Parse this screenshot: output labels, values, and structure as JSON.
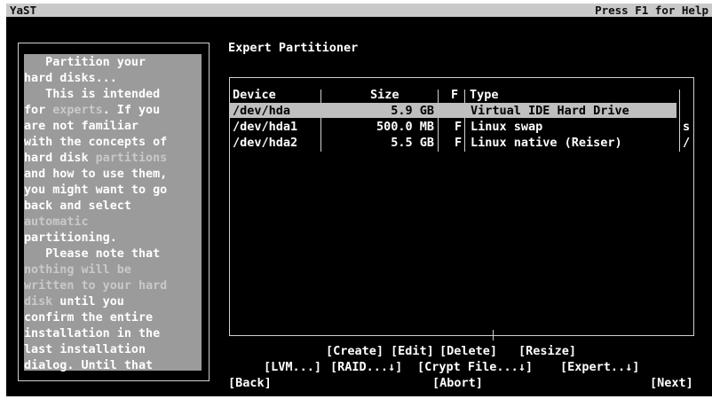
{
  "topbar": {
    "app_name": "YaST",
    "help_hint": "Press F1 for Help"
  },
  "help": {
    "lines": [
      {
        "text": "   Partition your",
        "dim": false
      },
      {
        "text": "hard disks...",
        "dim": false
      },
      {
        "text": "   This is intended",
        "dim": false
      },
      {
        "text": "for ",
        "dim": false,
        "parts": [
          {
            "text": "for ",
            "dim": false
          },
          {
            "text": "experts",
            "dim": true
          },
          {
            "text": ". If you",
            "dim": false
          }
        ]
      },
      {
        "text": "are not familiar",
        "dim": false
      },
      {
        "text": "with the concepts of",
        "dim": false
      },
      {
        "text": "hard disk ",
        "dim": false,
        "parts": [
          {
            "text": "hard disk ",
            "dim": false
          },
          {
            "text": "partitions",
            "dim": true
          }
        ]
      },
      {
        "text": "and how to use them,",
        "dim": false
      },
      {
        "text": "you might want to go",
        "dim": false
      },
      {
        "text": "back and select",
        "dim": false
      },
      {
        "text": "automatic",
        "dim": true
      },
      {
        "text": "partitioning.",
        "dim": false
      },
      {
        "text": "   Please note that",
        "dim": false
      },
      {
        "text": "nothing will be",
        "dim": true
      },
      {
        "text": "written to your hard",
        "dim": true
      },
      {
        "text": "disk",
        "dim": true,
        "parts": [
          {
            "text": "disk",
            "dim": true
          },
          {
            "text": " until you",
            "dim": false
          }
        ]
      },
      {
        "text": "confirm the entire",
        "dim": false
      },
      {
        "text": "installation in the",
        "dim": false
      },
      {
        "text": "last installation",
        "dim": false
      },
      {
        "text": "dialog. Until that",
        "dim": false
      }
    ]
  },
  "main": {
    "title": "Expert Partitioner"
  },
  "table": {
    "headers": {
      "device": "Device",
      "size": "Size",
      "f": "F",
      "type": "Type"
    },
    "rows": [
      {
        "device": "/dev/hda",
        "size": "5.9 GB",
        "f": "",
        "type": "Virtual IDE Hard Drive",
        "extra": "",
        "selected": true
      },
      {
        "device": "/dev/hda1",
        "size": "500.0 MB",
        "f": "F",
        "type": "Linux swap",
        "extra": "s",
        "selected": false
      },
      {
        "device": "/dev/hda2",
        "size": "5.5 GB",
        "f": "F",
        "type": "Linux native (Reiser)",
        "extra": "/",
        "selected": false
      }
    ]
  },
  "buttons": {
    "create": "[Create]",
    "edit": "[Edit]",
    "delete": "[Delete]",
    "resize": "[Resize]",
    "lvm": "[LVM...]",
    "raid": "[RAID...↓]",
    "crypt": "[Crypt File...↓]",
    "expert": "[Expert..↓]",
    "back": "[Back]",
    "abort": "[Abort]",
    "next": "[Next]"
  }
}
